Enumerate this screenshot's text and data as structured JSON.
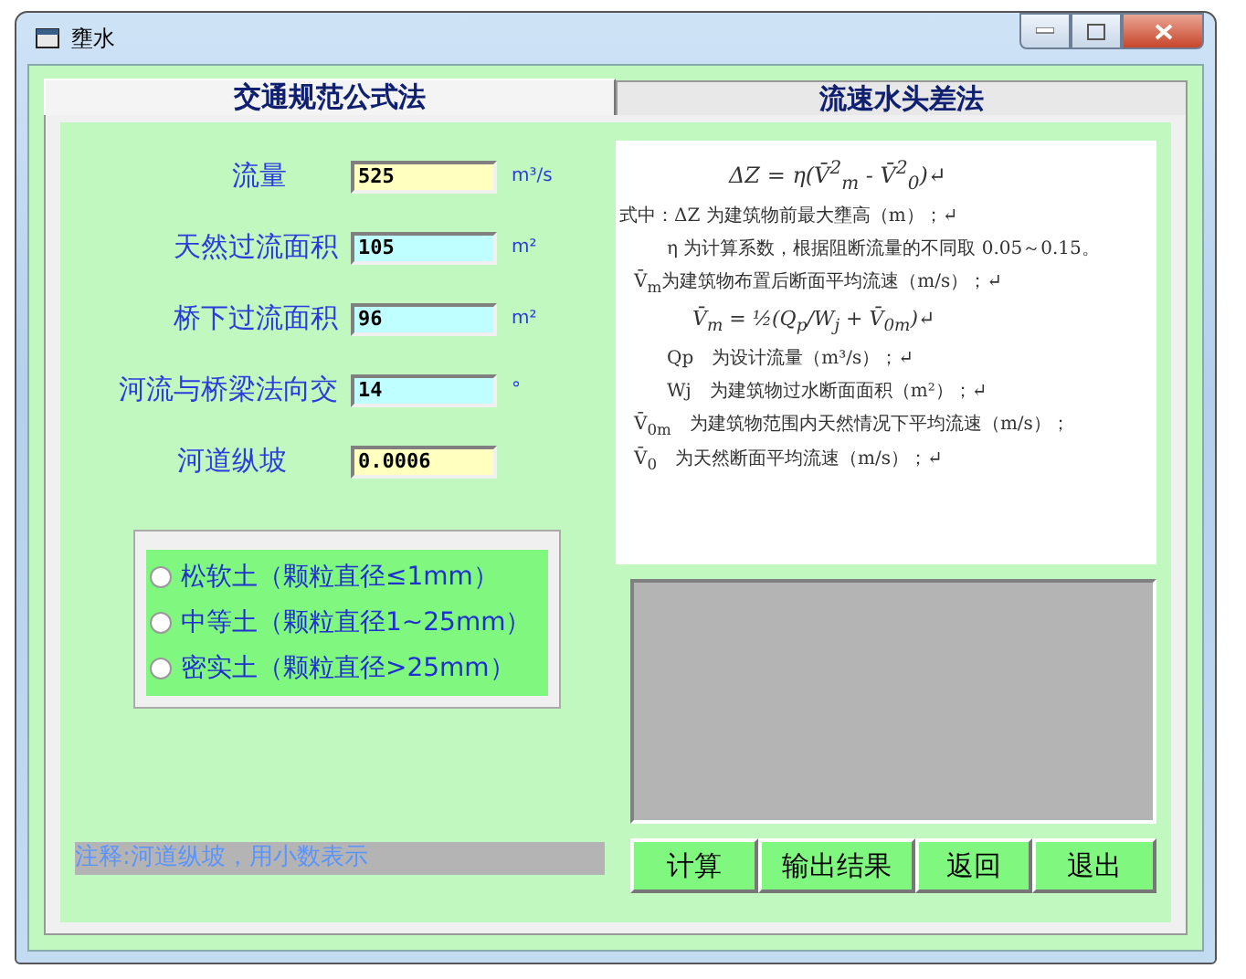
{
  "window": {
    "title": "壅水"
  },
  "tabs": [
    {
      "label": "交通规范公式法",
      "selected": true
    },
    {
      "label": "流速水头差法",
      "selected": false
    }
  ],
  "fields": [
    {
      "label": "流量",
      "value": "525",
      "unit": "m³/s",
      "color": "#ffffc0"
    },
    {
      "label": "天然过流面积",
      "value": "105",
      "unit": "m²",
      "color": "#c0ffff"
    },
    {
      "label": "桥下过流面积",
      "value": "96",
      "unit": "m²",
      "color": "#c0ffff"
    },
    {
      "label": "河流与桥梁法向交",
      "value": "14",
      "unit": "°",
      "color": "#c0ffff"
    },
    {
      "label": "河道纵坡",
      "value": "0.0006",
      "color": "#ffffc0"
    }
  ],
  "soil_options": [
    {
      "label": "松软土（颗粒直径≤1mm）",
      "selected": false
    },
    {
      "label": "中等土（颗粒直径1~25mm）",
      "selected": false
    },
    {
      "label": "密实土（颗粒直径>25mm）",
      "selected": false
    }
  ],
  "note": "注释:河道纵坡，用小数表示",
  "formula_lines": [
    {
      "text": "ΔZ = η(V̄$^{2}$$_{m}$ - V̄$^{2}$$_{0}$)↵",
      "kind": "formula"
    },
    {
      "text": "式中：ΔZ 为建筑物前最大壅高（m）；↵",
      "kind": "head"
    },
    {
      "text": "η 为计算系数，根据阻断流量的不同取 0.05～0.15。",
      "kind": "indent"
    },
    {
      "text": "V̄$_{m}$为建筑物布置后断面平均流速（m/s）；↵",
      "kind": "sym"
    },
    {
      "text": "V̄$_{m}$ = ½(Q$_{p}$/W$_{j}$ + V̄$_{0m}$)↵",
      "kind": "formula2"
    },
    {
      "text": "Qp　为设计流量（m³/s）；↵",
      "kind": "indent"
    },
    {
      "text": "Wj　为建筑物过水断面面积（m²）；↵",
      "kind": "indent"
    },
    {
      "text": "V̄$_{0m}$　为建筑物范围内天然情况下平均流速（m/s）；",
      "kind": "sym"
    },
    {
      "text": "V̄$_{0}$　为天然断面平均流速（m/s）；↵",
      "kind": "sym"
    }
  ],
  "buttons": [
    "计算",
    "输出结果",
    "返回",
    "退出"
  ]
}
